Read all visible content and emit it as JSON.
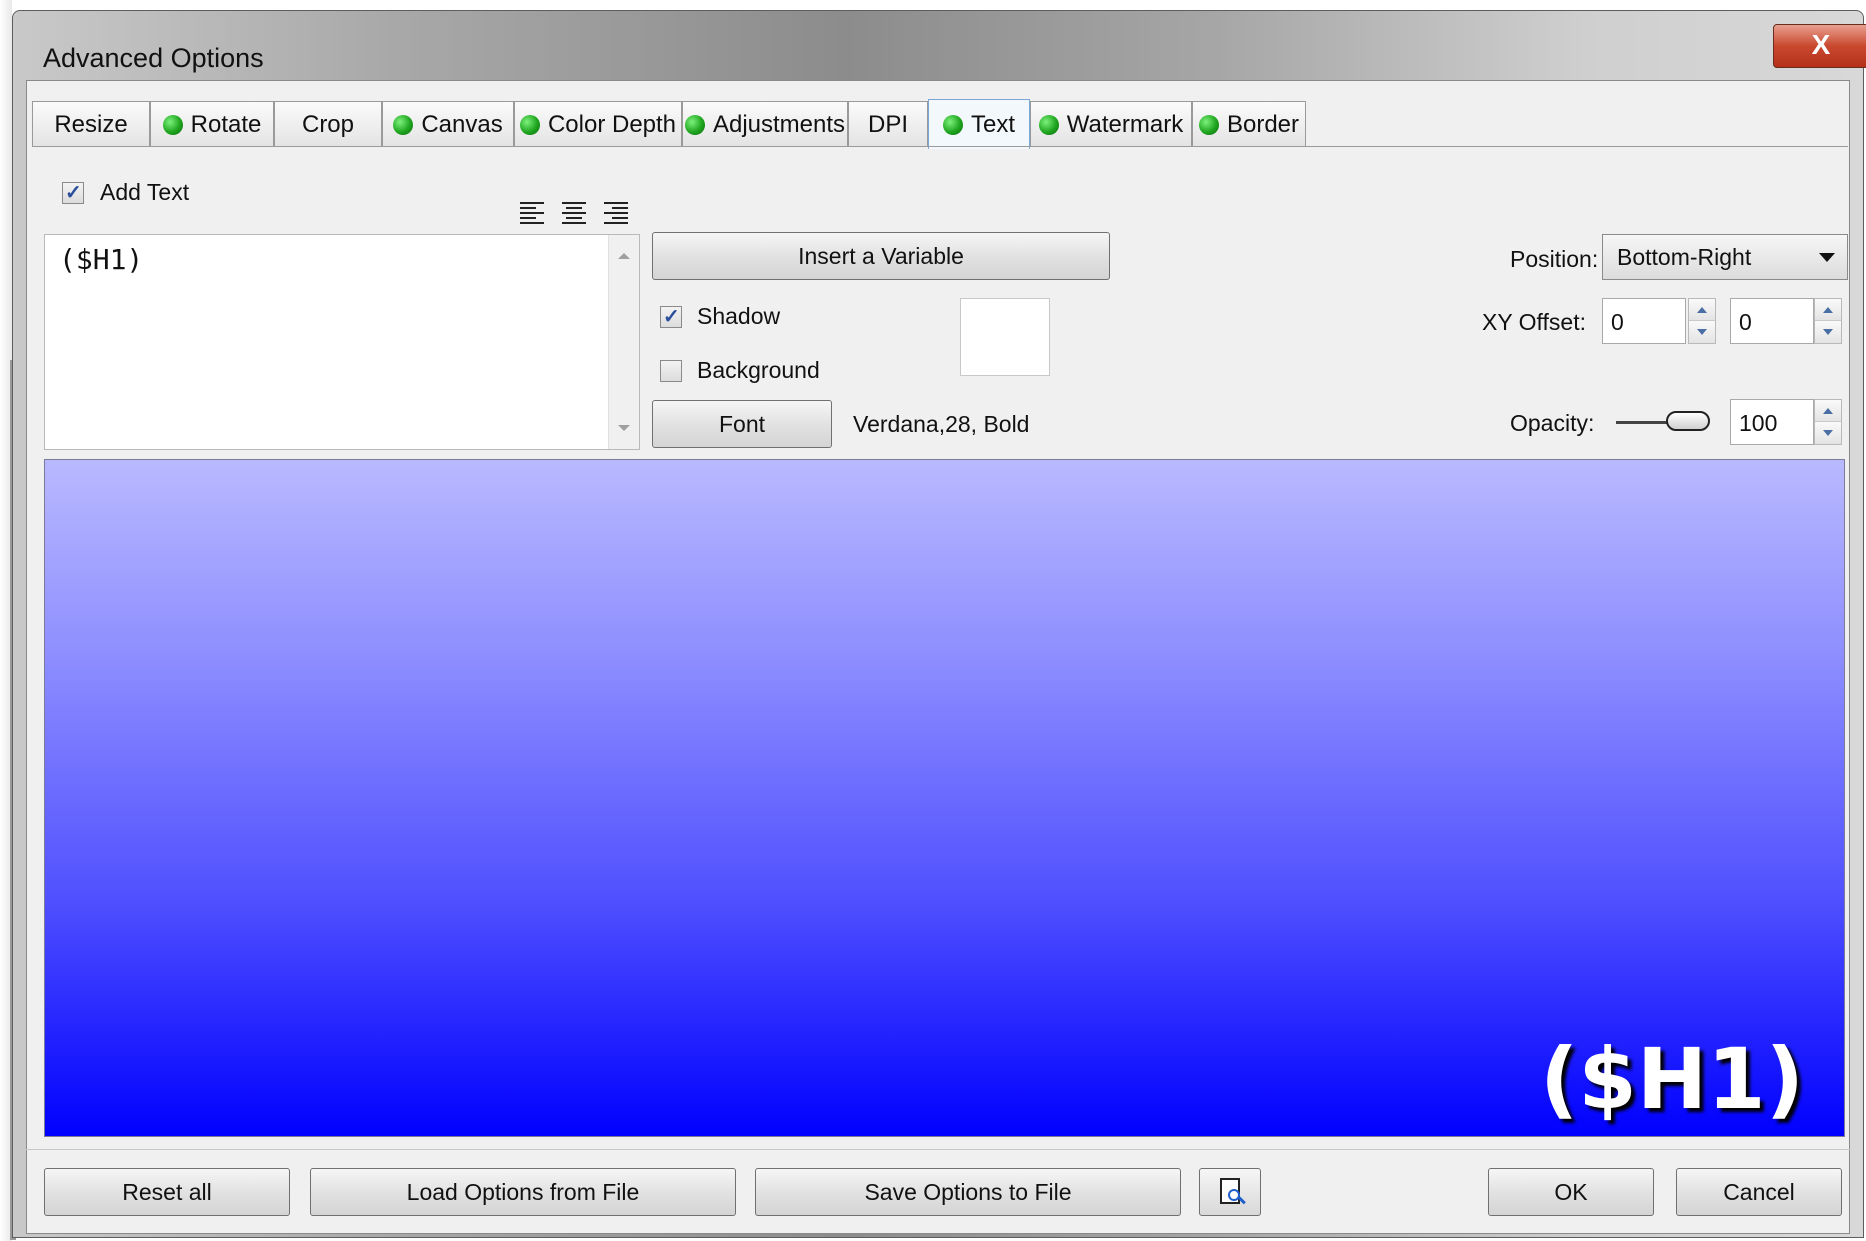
{
  "window": {
    "title": "Advanced Options",
    "close_label": "X"
  },
  "tabs": [
    {
      "label": "Resize",
      "dot": false
    },
    {
      "label": "Rotate",
      "dot": true
    },
    {
      "label": "Crop",
      "dot": false
    },
    {
      "label": "Canvas",
      "dot": true
    },
    {
      "label": "Color Depth",
      "dot": true
    },
    {
      "label": "Adjustments",
      "dot": true
    },
    {
      "label": "DPI",
      "dot": false
    },
    {
      "label": "Text",
      "dot": true,
      "active": true
    },
    {
      "label": "Watermark",
      "dot": true
    },
    {
      "label": "Border",
      "dot": true
    }
  ],
  "text_panel": {
    "add_text_label": "Add Text",
    "add_text_checked": true,
    "text_value": "($H1)",
    "insert_variable_label": "Insert a Variable",
    "shadow_label": "Shadow",
    "shadow_checked": true,
    "background_label": "Background",
    "background_checked": false,
    "font_button_label": "Font",
    "font_description": "Verdana,28, Bold",
    "position_label": "Position:",
    "position_value": "Bottom-Right",
    "xy_offset_label": "XY Offset:",
    "x_offset": "0",
    "y_offset": "0",
    "opacity_label": "Opacity:",
    "opacity_value": "100",
    "align_icons": [
      "align-left-icon",
      "align-center-icon",
      "align-right-icon"
    ]
  },
  "preview": {
    "text": "($H1)",
    "gradient_top": "#b9b9ff",
    "gradient_bottom": "#0000ff"
  },
  "footer": {
    "reset_label": "Reset all",
    "load_label": "Load Options from File",
    "save_label": "Save Options to File",
    "preview_icon": "preview-document-icon",
    "ok_label": "OK",
    "cancel_label": "Cancel"
  }
}
